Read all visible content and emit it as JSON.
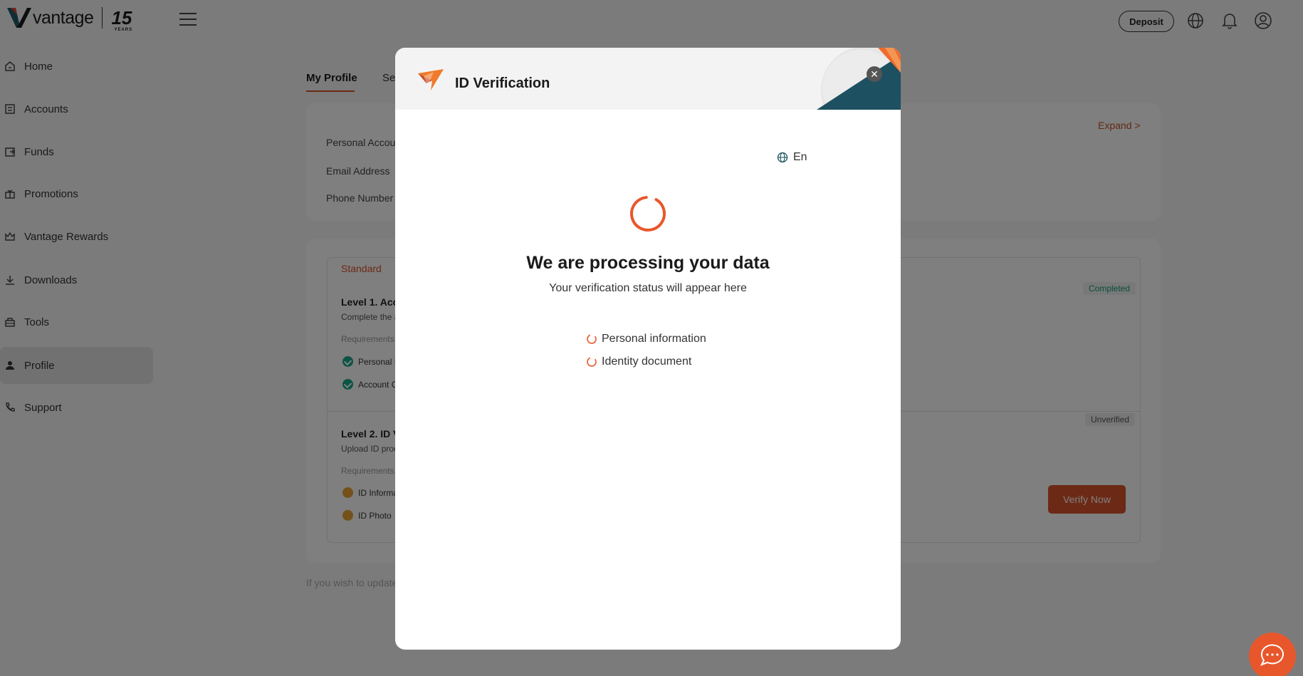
{
  "header": {
    "brand": "vantage",
    "anniversary": "15",
    "anniversary_sub": "YEARS",
    "deposit_label": "Deposit"
  },
  "sidebar": {
    "items": [
      {
        "label": "Home",
        "icon": "home-icon"
      },
      {
        "label": "Accounts",
        "icon": "accounts-icon"
      },
      {
        "label": "Funds",
        "icon": "funds-icon"
      },
      {
        "label": "Promotions",
        "icon": "gift-icon"
      },
      {
        "label": "Vantage Rewards",
        "icon": "crown-icon"
      },
      {
        "label": "Downloads",
        "icon": "download-icon"
      },
      {
        "label": "Tools",
        "icon": "toolbox-icon"
      },
      {
        "label": "Profile",
        "icon": "user-icon",
        "active": true
      },
      {
        "label": "Support",
        "icon": "phone-icon"
      }
    ]
  },
  "main": {
    "tabs": [
      "My Profile",
      "Se"
    ],
    "info_labels": [
      "Personal Accou",
      "Email Address",
      "Phone Number"
    ],
    "expand_label": "Expand >",
    "verification": {
      "tab": "Standard",
      "level1": {
        "title": "Level 1. Acc",
        "subtitle": "Complete the a",
        "requirements_label": "Requirements",
        "items": [
          "Personal I",
          "Account C"
        ],
        "status": "Completed"
      },
      "level2": {
        "title": "Level 2. ID V",
        "subtitle": "Upload ID proc",
        "requirements_label": "Requirements",
        "items": [
          "ID Informa",
          "ID Photo"
        ],
        "status": "Unverified",
        "action": "Verify Now"
      }
    },
    "footnote": "If you wish to update"
  },
  "modal": {
    "title": "ID Verification",
    "language": "En",
    "heading": "We are processing your data",
    "subheading": "Your verification status will appear here",
    "checks": [
      "Personal information",
      "Identity document"
    ]
  },
  "colors": {
    "accent": "#d9532b",
    "success": "#1aa88a",
    "pending": "#e8a235"
  }
}
